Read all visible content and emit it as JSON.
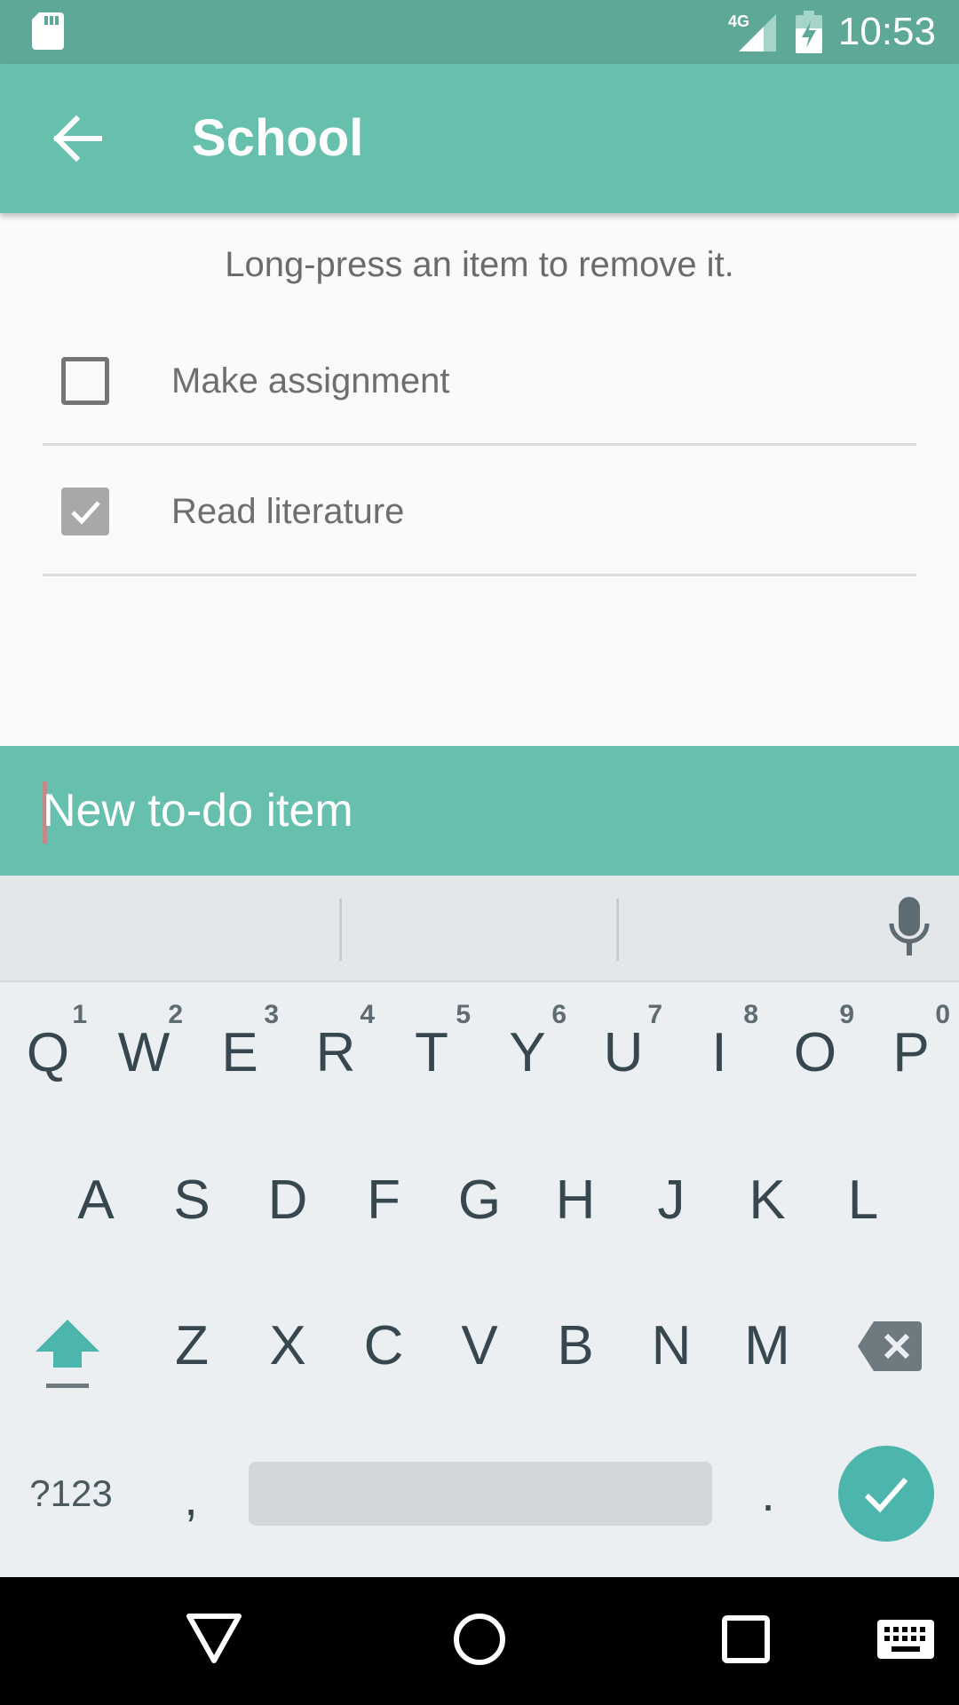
{
  "status_bar": {
    "time": "10:53",
    "network": "4G"
  },
  "app_bar": {
    "title": "School"
  },
  "hint": "Long-press an item to remove it.",
  "todos": [
    {
      "label": "Make assignment",
      "checked": false
    },
    {
      "label": "Read literature",
      "checked": true
    }
  ],
  "input": {
    "placeholder": "New to-do item",
    "value": ""
  },
  "keyboard": {
    "row1": [
      {
        "key": "Q",
        "hint": "1"
      },
      {
        "key": "W",
        "hint": "2"
      },
      {
        "key": "E",
        "hint": "3"
      },
      {
        "key": "R",
        "hint": "4"
      },
      {
        "key": "T",
        "hint": "5"
      },
      {
        "key": "Y",
        "hint": "6"
      },
      {
        "key": "U",
        "hint": "7"
      },
      {
        "key": "I",
        "hint": "8"
      },
      {
        "key": "O",
        "hint": "9"
      },
      {
        "key": "P",
        "hint": "0"
      }
    ],
    "row2": [
      "A",
      "S",
      "D",
      "F",
      "G",
      "H",
      "J",
      "K",
      "L"
    ],
    "row3": [
      "Z",
      "X",
      "C",
      "V",
      "B",
      "N",
      "M"
    ],
    "symbols_label": "?123",
    "comma": ",",
    "period": "."
  },
  "colors": {
    "primary": "#66c0ad",
    "primary_dark": "#5ea898",
    "accent": "#4db6ac"
  }
}
